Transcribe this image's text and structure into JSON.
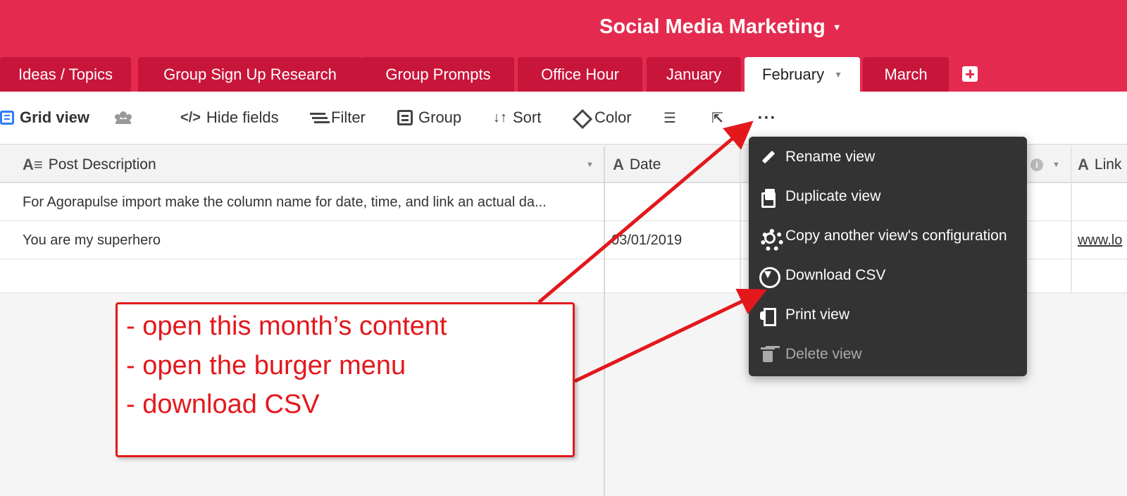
{
  "header": {
    "base_title": "Social Media Marketing"
  },
  "tabs": [
    {
      "label": "Ideas / Topics"
    },
    {
      "label": "Group Sign Up Research"
    },
    {
      "label": "Group Prompts"
    },
    {
      "label": "Office Hour"
    },
    {
      "label": "January"
    },
    {
      "label": "February"
    },
    {
      "label": "March"
    }
  ],
  "toolbar": {
    "view_name": "Grid view",
    "hide_fields": "Hide fields",
    "filter": "Filter",
    "group": "Group",
    "sort": "Sort",
    "color": "Color",
    "more": "···"
  },
  "grid": {
    "columns": [
      {
        "label": "Post Description"
      },
      {
        "label": "Date"
      },
      {
        "label": "Link"
      }
    ],
    "rows": [
      {
        "description": "For Agorapulse import make the column name for date, time, and link an actual da...",
        "date": "",
        "link": ""
      },
      {
        "description": "You are my superhero",
        "date": "03/01/2019",
        "link": "www.lo"
      }
    ]
  },
  "menu": {
    "items": [
      {
        "label": "Rename view",
        "icon": "pencil-icon"
      },
      {
        "label": "Duplicate view",
        "icon": "duplicate-icon"
      },
      {
        "label": "Copy another view's configuration",
        "icon": "gear-icon"
      },
      {
        "label": "Download CSV",
        "icon": "download-icon"
      },
      {
        "label": "Print view",
        "icon": "printer-icon"
      },
      {
        "label": "Delete view",
        "icon": "trash-icon"
      }
    ]
  },
  "annotation": {
    "lines": [
      "- open this month’s content",
      "- open the burger menu",
      "- download CSV"
    ],
    "color": "#e3181c"
  },
  "colors": {
    "brand": "#e42b4f",
    "tab": "#c8153a",
    "menu_bg": "#333333",
    "accent": "#2d7ff9"
  }
}
